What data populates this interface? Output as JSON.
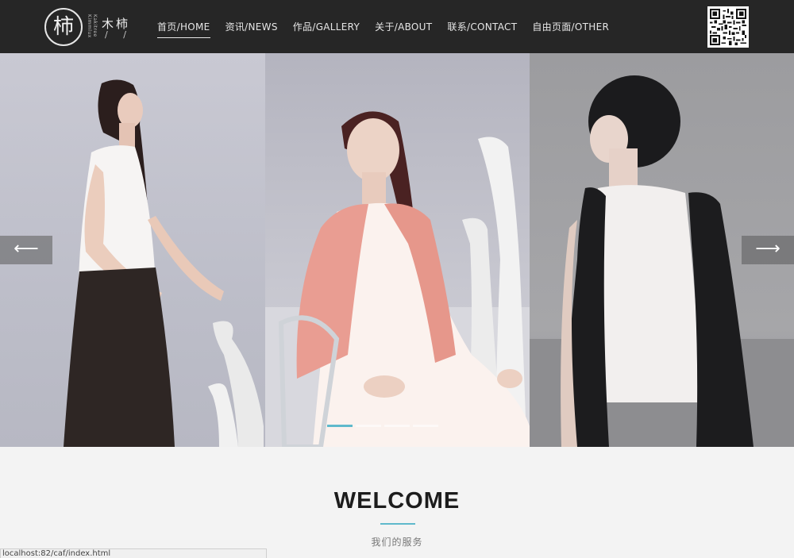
{
  "header": {
    "logo": {
      "mark": "柿",
      "sub": "Kakitree Kimmlux",
      "name": "木柿",
      "slashes": "/ /"
    },
    "nav": [
      {
        "label": "首页/HOME",
        "active": true
      },
      {
        "label": "资讯/NEWS",
        "active": false
      },
      {
        "label": "作品/GALLERY",
        "active": false
      },
      {
        "label": "关于/ABOUT",
        "active": false
      },
      {
        "label": "联系/CONTACT",
        "active": false
      },
      {
        "label": "自由页面/OTHER",
        "active": false
      }
    ],
    "qr_icon": "qr-code-icon"
  },
  "slider": {
    "prev_arrow": "⟵",
    "next_arrow": "⟶",
    "dots_count": 4,
    "active_dot": 0,
    "accent": "#5fb9cc"
  },
  "welcome": {
    "title": "WELCOME",
    "subtitle": "我们的服务"
  },
  "status_bar": "localhost:82/caf/index.html"
}
